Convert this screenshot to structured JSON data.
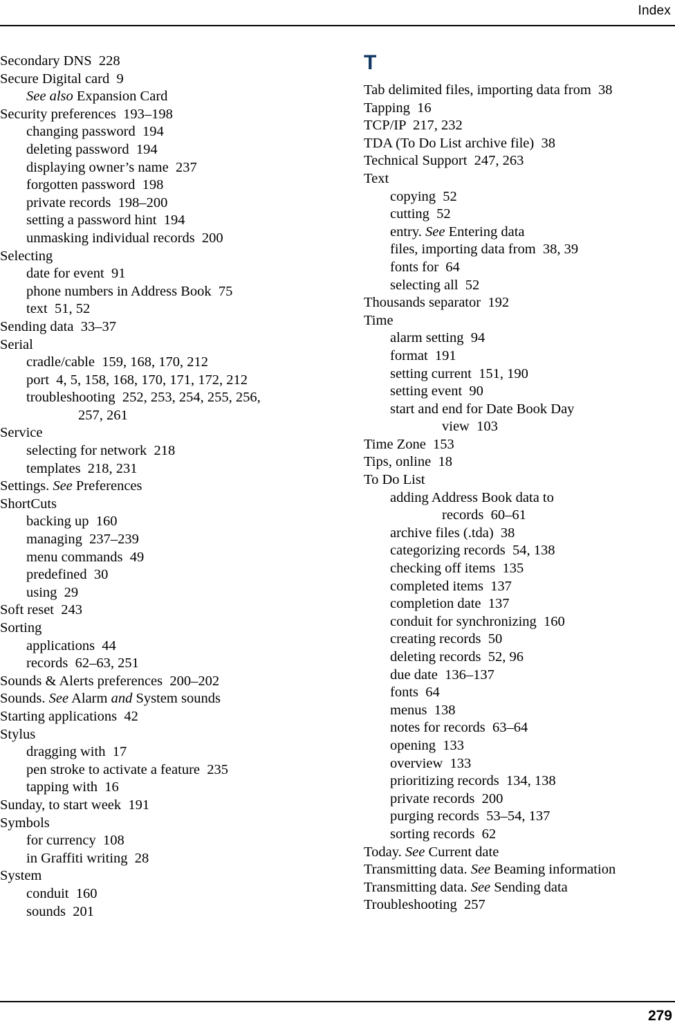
{
  "page": {
    "running_head": "Index",
    "folio": "279",
    "accent_color": "#123a63"
  },
  "columns": [
    {
      "name": "left-column",
      "section_letter": null,
      "entries": [
        {
          "level": 0,
          "parts": [
            {
              "text": "Secondary DNS  228"
            }
          ]
        },
        {
          "level": 0,
          "parts": [
            {
              "text": "Secure Digital card  9"
            }
          ]
        },
        {
          "level": 1,
          "parts": [
            {
              "text": "See also",
              "italic": true
            },
            {
              "text": " Expansion Card"
            }
          ]
        },
        {
          "level": 0,
          "parts": [
            {
              "text": "Security preferences  193–198"
            }
          ]
        },
        {
          "level": 1,
          "parts": [
            {
              "text": "changing password  194"
            }
          ]
        },
        {
          "level": 1,
          "parts": [
            {
              "text": "deleting password  194"
            }
          ]
        },
        {
          "level": 1,
          "parts": [
            {
              "text": "displaying owner’s name  237"
            }
          ]
        },
        {
          "level": 1,
          "parts": [
            {
              "text": "forgotten password  198"
            }
          ]
        },
        {
          "level": 1,
          "parts": [
            {
              "text": "private records  198–200"
            }
          ]
        },
        {
          "level": 1,
          "parts": [
            {
              "text": "setting a password hint  194"
            }
          ]
        },
        {
          "level": 1,
          "parts": [
            {
              "text": "unmasking individual records  200"
            }
          ]
        },
        {
          "level": 0,
          "parts": [
            {
              "text": "Selecting"
            }
          ]
        },
        {
          "level": 1,
          "parts": [
            {
              "text": "date for event  91"
            }
          ]
        },
        {
          "level": 1,
          "parts": [
            {
              "text": "phone numbers in Address Book  75"
            }
          ]
        },
        {
          "level": 1,
          "parts": [
            {
              "text": "text  51, 52"
            }
          ]
        },
        {
          "level": 0,
          "parts": [
            {
              "text": "Sending data  33–37"
            }
          ]
        },
        {
          "level": 0,
          "parts": [
            {
              "text": "Serial"
            }
          ]
        },
        {
          "level": 1,
          "parts": [
            {
              "text": "cradle/cable  159, 168, 170, 212"
            }
          ]
        },
        {
          "level": 1,
          "parts": [
            {
              "text": "port  4, 5, 158, 168, 170, 171, 172, 212"
            }
          ]
        },
        {
          "level": 1,
          "parts": [
            {
              "text": "troubleshooting  252, 253, 254, 255, 256,"
            }
          ]
        },
        {
          "level": 2,
          "parts": [
            {
              "text": "257, 261"
            }
          ]
        },
        {
          "level": 0,
          "parts": [
            {
              "text": "Service"
            }
          ]
        },
        {
          "level": 1,
          "parts": [
            {
              "text": "selecting for network  218"
            }
          ]
        },
        {
          "level": 1,
          "parts": [
            {
              "text": "templates  218, 231"
            }
          ]
        },
        {
          "level": 0,
          "parts": [
            {
              "text": "Settings. "
            },
            {
              "text": "See",
              "italic": true
            },
            {
              "text": " Preferences"
            }
          ]
        },
        {
          "level": 0,
          "parts": [
            {
              "text": "ShortCuts"
            }
          ]
        },
        {
          "level": 1,
          "parts": [
            {
              "text": "backing up  160"
            }
          ]
        },
        {
          "level": 1,
          "parts": [
            {
              "text": "managing  237–239"
            }
          ]
        },
        {
          "level": 1,
          "parts": [
            {
              "text": "menu commands  49"
            }
          ]
        },
        {
          "level": 1,
          "parts": [
            {
              "text": "predefined  30"
            }
          ]
        },
        {
          "level": 1,
          "parts": [
            {
              "text": "using  29"
            }
          ]
        },
        {
          "level": 0,
          "parts": [
            {
              "text": "Soft reset  243"
            }
          ]
        },
        {
          "level": 0,
          "parts": [
            {
              "text": "Sorting"
            }
          ]
        },
        {
          "level": 1,
          "parts": [
            {
              "text": "applications  44"
            }
          ]
        },
        {
          "level": 1,
          "parts": [
            {
              "text": "records  62–63, 251"
            }
          ]
        },
        {
          "level": 0,
          "parts": [
            {
              "text": "Sounds & Alerts preferences  200–202"
            }
          ]
        },
        {
          "level": 0,
          "parts": [
            {
              "text": "Sounds. "
            },
            {
              "text": "See",
              "italic": true
            },
            {
              "text": " Alarm "
            },
            {
              "text": "and",
              "italic": true
            },
            {
              "text": " System sounds"
            }
          ]
        },
        {
          "level": 0,
          "parts": [
            {
              "text": "Starting applications  42"
            }
          ]
        },
        {
          "level": 0,
          "parts": [
            {
              "text": "Stylus"
            }
          ]
        },
        {
          "level": 1,
          "parts": [
            {
              "text": "dragging with  17"
            }
          ]
        },
        {
          "level": 1,
          "parts": [
            {
              "text": "pen stroke to activate a feature  235"
            }
          ]
        },
        {
          "level": 1,
          "parts": [
            {
              "text": "tapping with  16"
            }
          ]
        },
        {
          "level": 0,
          "parts": [
            {
              "text": "Sunday, to start week  191"
            }
          ]
        },
        {
          "level": 0,
          "parts": [
            {
              "text": "Symbols"
            }
          ]
        },
        {
          "level": 1,
          "parts": [
            {
              "text": "for currency  108"
            }
          ]
        },
        {
          "level": 1,
          "parts": [
            {
              "text": "in Graffiti writing  28"
            }
          ]
        },
        {
          "level": 0,
          "parts": [
            {
              "text": "System"
            }
          ]
        },
        {
          "level": 1,
          "parts": [
            {
              "text": "conduit  160"
            }
          ]
        },
        {
          "level": 1,
          "parts": [
            {
              "text": "sounds  201"
            }
          ]
        }
      ]
    },
    {
      "name": "right-column",
      "section_letter": "T",
      "entries": [
        {
          "level": 0,
          "parts": [
            {
              "text": "Tab delimited files, importing data from  38"
            }
          ]
        },
        {
          "level": 0,
          "parts": [
            {
              "text": "Tapping  16"
            }
          ]
        },
        {
          "level": 0,
          "parts": [
            {
              "text": "TCP/IP  217, 232"
            }
          ]
        },
        {
          "level": 0,
          "parts": [
            {
              "text": "TDA (To Do List archive file)  38"
            }
          ]
        },
        {
          "level": 0,
          "parts": [
            {
              "text": "Technical Support  247, 263"
            }
          ]
        },
        {
          "level": 0,
          "parts": [
            {
              "text": "Text"
            }
          ]
        },
        {
          "level": 1,
          "parts": [
            {
              "text": "copying  52"
            }
          ]
        },
        {
          "level": 1,
          "parts": [
            {
              "text": "cutting  52"
            }
          ]
        },
        {
          "level": 1,
          "parts": [
            {
              "text": "entry. "
            },
            {
              "text": "See",
              "italic": true
            },
            {
              "text": " Entering data"
            }
          ]
        },
        {
          "level": 1,
          "parts": [
            {
              "text": "files, importing data from  38, 39"
            }
          ]
        },
        {
          "level": 1,
          "parts": [
            {
              "text": "fonts for  64"
            }
          ]
        },
        {
          "level": 1,
          "parts": [
            {
              "text": "selecting all  52"
            }
          ]
        },
        {
          "level": 0,
          "parts": [
            {
              "text": "Thousands separator  192"
            }
          ]
        },
        {
          "level": 0,
          "parts": [
            {
              "text": "Time"
            }
          ]
        },
        {
          "level": 1,
          "parts": [
            {
              "text": "alarm setting  94"
            }
          ]
        },
        {
          "level": 1,
          "parts": [
            {
              "text": "format  191"
            }
          ]
        },
        {
          "level": 1,
          "parts": [
            {
              "text": "setting current  151, 190"
            }
          ]
        },
        {
          "level": 1,
          "parts": [
            {
              "text": "setting event  90"
            }
          ]
        },
        {
          "level": 1,
          "parts": [
            {
              "text": "start and end for Date Book Day"
            }
          ]
        },
        {
          "level": 2,
          "parts": [
            {
              "text": "view  103"
            }
          ]
        },
        {
          "level": 0,
          "parts": [
            {
              "text": "Time Zone  153"
            }
          ]
        },
        {
          "level": 0,
          "parts": [
            {
              "text": "Tips, online  18"
            }
          ]
        },
        {
          "level": 0,
          "parts": [
            {
              "text": "To Do List"
            }
          ]
        },
        {
          "level": 1,
          "parts": [
            {
              "text": "adding Address Book data to"
            }
          ]
        },
        {
          "level": 2,
          "parts": [
            {
              "text": "records  60–61"
            }
          ]
        },
        {
          "level": 1,
          "parts": [
            {
              "text": "archive files (.tda)  38"
            }
          ]
        },
        {
          "level": 1,
          "parts": [
            {
              "text": "categorizing records  54, 138"
            }
          ]
        },
        {
          "level": 1,
          "parts": [
            {
              "text": "checking off items  135"
            }
          ]
        },
        {
          "level": 1,
          "parts": [
            {
              "text": "completed items  137"
            }
          ]
        },
        {
          "level": 1,
          "parts": [
            {
              "text": "completion date  137"
            }
          ]
        },
        {
          "level": 1,
          "parts": [
            {
              "text": "conduit for synchronizing  160"
            }
          ]
        },
        {
          "level": 1,
          "parts": [
            {
              "text": "creating records  50"
            }
          ]
        },
        {
          "level": 1,
          "parts": [
            {
              "text": "deleting records  52, 96"
            }
          ]
        },
        {
          "level": 1,
          "parts": [
            {
              "text": "due date  136–137"
            }
          ]
        },
        {
          "level": 1,
          "parts": [
            {
              "text": "fonts  64"
            }
          ]
        },
        {
          "level": 1,
          "parts": [
            {
              "text": "menus  138"
            }
          ]
        },
        {
          "level": 1,
          "parts": [
            {
              "text": "notes for records  63–64"
            }
          ]
        },
        {
          "level": 1,
          "parts": [
            {
              "text": "opening  133"
            }
          ]
        },
        {
          "level": 1,
          "parts": [
            {
              "text": "overview  133"
            }
          ]
        },
        {
          "level": 1,
          "parts": [
            {
              "text": "prioritizing records  134, 138"
            }
          ]
        },
        {
          "level": 1,
          "parts": [
            {
              "text": "private records  200"
            }
          ]
        },
        {
          "level": 1,
          "parts": [
            {
              "text": "purging records  53–54, 137"
            }
          ]
        },
        {
          "level": 1,
          "parts": [
            {
              "text": "sorting records  62"
            }
          ]
        },
        {
          "level": 0,
          "parts": [
            {
              "text": "Today. "
            },
            {
              "text": "See",
              "italic": true
            },
            {
              "text": " Current date"
            }
          ]
        },
        {
          "level": 0,
          "parts": [
            {
              "text": "Transmitting data. "
            },
            {
              "text": "See",
              "italic": true
            },
            {
              "text": " Beaming information"
            }
          ]
        },
        {
          "level": 0,
          "parts": [
            {
              "text": "Transmitting data. "
            },
            {
              "text": "See",
              "italic": true
            },
            {
              "text": " Sending data"
            }
          ]
        },
        {
          "level": 0,
          "parts": [
            {
              "text": "Troubleshooting  257"
            }
          ]
        }
      ]
    }
  ]
}
